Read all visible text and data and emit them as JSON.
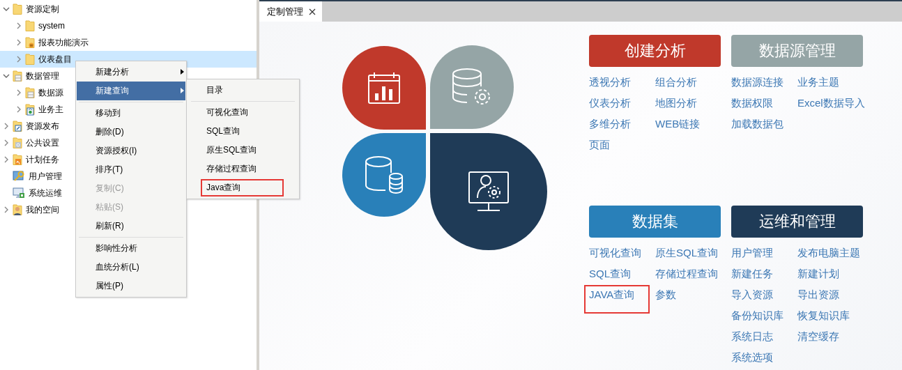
{
  "tree": {
    "items": [
      {
        "label": "资源定制",
        "kind": "folder",
        "expanded": true,
        "selected": false,
        "children": [
          {
            "label": "system",
            "kind": "folder",
            "expanded": false,
            "selected": false
          },
          {
            "label": "报表功能演示",
            "kind": "report",
            "expanded": false,
            "selected": false
          },
          {
            "label": "仪表盘目",
            "kind": "folder",
            "expanded": false,
            "selected": true
          }
        ]
      },
      {
        "label": "数据管理",
        "kind": "data",
        "expanded": true,
        "selected": false,
        "children": [
          {
            "label": "数据源",
            "kind": "data",
            "expanded": false,
            "selected": false
          },
          {
            "label": "业务主",
            "kind": "theme",
            "expanded": false,
            "selected": false
          }
        ]
      },
      {
        "label": "资源发布",
        "kind": "publish",
        "expanded": false,
        "selected": false
      },
      {
        "label": "公共设置",
        "kind": "settings",
        "expanded": false,
        "selected": false
      },
      {
        "label": "计划任务",
        "kind": "schedule",
        "expanded": false,
        "selected": false
      },
      {
        "label": "用户管理",
        "kind": "users",
        "selected": false
      },
      {
        "label": "系统运维",
        "kind": "operations",
        "selected": false
      },
      {
        "label": "我的空间",
        "kind": "personal",
        "expanded": false,
        "selected": false
      }
    ]
  },
  "context_menu": {
    "items": [
      {
        "label": "新建分析",
        "selected": false,
        "disabled": false,
        "has_submenu": true,
        "separator_after": false
      },
      {
        "label": "新建查询",
        "selected": true,
        "disabled": false,
        "has_submenu": true,
        "separator_after": true
      },
      {
        "label": "移动到",
        "selected": false,
        "disabled": false,
        "has_submenu": false,
        "separator_after": false
      },
      {
        "label": "删除(D)",
        "selected": false,
        "disabled": false,
        "has_submenu": false,
        "separator_after": false
      },
      {
        "label": "资源授权(I)",
        "selected": false,
        "disabled": false,
        "has_submenu": false,
        "separator_after": false
      },
      {
        "label": "排序(T)",
        "selected": false,
        "disabled": false,
        "has_submenu": false,
        "separator_after": false
      },
      {
        "label": "复制(C)",
        "selected": false,
        "disabled": true,
        "has_submenu": false,
        "separator_after": false
      },
      {
        "label": "粘贴(S)",
        "selected": false,
        "disabled": true,
        "has_submenu": false,
        "separator_after": false
      },
      {
        "label": "刷新(R)",
        "selected": false,
        "disabled": false,
        "has_submenu": false,
        "separator_after": true
      },
      {
        "label": "影响性分析",
        "selected": false,
        "disabled": false,
        "has_submenu": false,
        "separator_after": false
      },
      {
        "label": "血统分析(L)",
        "selected": false,
        "disabled": false,
        "has_submenu": false,
        "separator_after": false
      },
      {
        "label": "属性(P)",
        "selected": false,
        "disabled": false,
        "has_submenu": false,
        "separator_after": false
      }
    ]
  },
  "submenu": {
    "items": [
      {
        "label": "目录",
        "highlighted": false,
        "separator_after": true
      },
      {
        "label": "可视化查询",
        "highlighted": false,
        "separator_after": false
      },
      {
        "label": "SQL查询",
        "highlighted": false,
        "separator_after": false
      },
      {
        "label": "原生SQL查询",
        "highlighted": false,
        "separator_after": false
      },
      {
        "label": "存储过程查询",
        "highlighted": false,
        "separator_after": false
      },
      {
        "label": "Java查询",
        "highlighted": true,
        "separator_after": false
      }
    ]
  },
  "tabs": [
    {
      "label": "定制管理",
      "selected": true
    }
  ],
  "petals": [
    {
      "kind": "analysis",
      "color": "#c0392b"
    },
    {
      "kind": "datasource",
      "color": "#95a5a6"
    },
    {
      "kind": "dataset",
      "color": "#2980b9"
    },
    {
      "kind": "admin",
      "color": "#1f3b57"
    }
  ],
  "sections": [
    {
      "title": "创建分析",
      "color": "#c0392b",
      "links": [
        {
          "label": "透视分析",
          "highlighted": false
        },
        {
          "label": "组合分析",
          "highlighted": false
        },
        {
          "label": "仪表分析",
          "highlighted": false
        },
        {
          "label": "地图分析",
          "highlighted": false
        },
        {
          "label": "多维分析",
          "highlighted": false
        },
        {
          "label": "WEB链接",
          "highlighted": false
        },
        {
          "label": "页面",
          "highlighted": false
        }
      ]
    },
    {
      "title": "数据源管理",
      "color": "#95a5a6",
      "links": [
        {
          "label": "数据源连接",
          "highlighted": false
        },
        {
          "label": "业务主题",
          "highlighted": false
        },
        {
          "label": "数据权限",
          "highlighted": false
        },
        {
          "label": "Excel数据导入",
          "highlighted": false
        },
        {
          "label": "加载数据包",
          "highlighted": false
        }
      ]
    },
    {
      "title": "数据集",
      "color": "#2980b9",
      "links": [
        {
          "label": "可视化查询",
          "highlighted": false
        },
        {
          "label": "原生SQL查询",
          "highlighted": false
        },
        {
          "label": "SQL查询",
          "highlighted": false
        },
        {
          "label": "存储过程查询",
          "highlighted": false
        },
        {
          "label": "JAVA查询",
          "highlighted": true
        },
        {
          "label": "参数",
          "highlighted": false
        }
      ]
    },
    {
      "title": "运维和管理",
      "color": "#1f3b57",
      "links": [
        {
          "label": "用户管理",
          "highlighted": false
        },
        {
          "label": "发布电脑主题",
          "highlighted": false
        },
        {
          "label": "新建任务",
          "highlighted": false
        },
        {
          "label": "新建计划",
          "highlighted": false
        },
        {
          "label": "导入资源",
          "highlighted": false
        },
        {
          "label": "导出资源",
          "highlighted": false
        },
        {
          "label": "备份知识库",
          "highlighted": false
        },
        {
          "label": "恢复知识库",
          "highlighted": false
        },
        {
          "label": "系统日志",
          "highlighted": false
        },
        {
          "label": "清空缓存",
          "highlighted": false
        },
        {
          "label": "系统选项",
          "highlighted": false
        }
      ]
    }
  ]
}
